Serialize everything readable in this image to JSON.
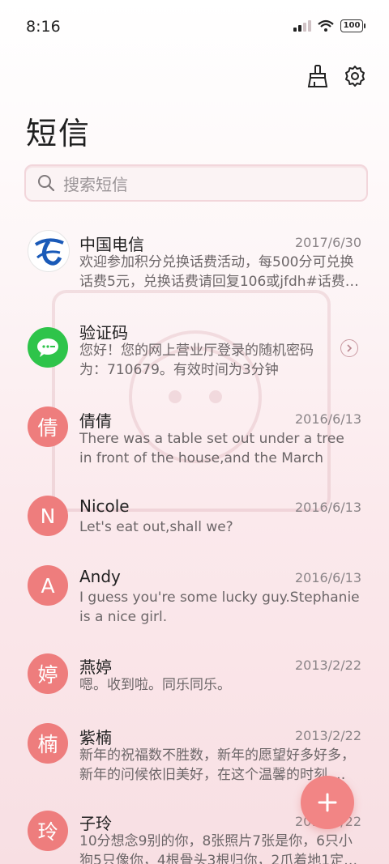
{
  "status": {
    "time": "8:16",
    "battery": "100"
  },
  "header": {
    "title": "短信"
  },
  "search": {
    "placeholder": "搜索短信"
  },
  "messages": [
    {
      "sender": "中国电信",
      "date": "2017/6/30",
      "preview": "欢迎参加积分兑换话费活动，每500分可兑换话费5元，兑换话费请回复106或jfdh#话费…",
      "avatar": "telecom-logo-icon"
    },
    {
      "sender": "验证码",
      "date": "",
      "preview": "您好！您的网上营业厅登录的随机密码为：710679。有效时间为3分钟",
      "avatar": "message-bubble-icon"
    },
    {
      "sender": "倩倩",
      "date": "2016/6/13",
      "preview": "There was a table set out under a tree in front of the house,and the March Hare an…",
      "avatar": "倩"
    },
    {
      "sender": "Nicole",
      "date": "2016/6/13",
      "preview": "Let's eat out,shall we?",
      "avatar": "N"
    },
    {
      "sender": "Andy",
      "date": "2016/6/13",
      "preview": "I guess you're some lucky guy.Stephanie is a nice girl.",
      "avatar": "A"
    },
    {
      "sender": "燕婷",
      "date": "2013/2/22",
      "preview": "嗯。收到啦。同乐同乐。",
      "avatar": "婷"
    },
    {
      "sender": "紫楠",
      "date": "2013/2/22",
      "preview": "新年的祝福数不胜数，新年的愿望好多好多，新年的问候依旧美好，在这个温馨的时刻 …",
      "avatar": "楠"
    },
    {
      "sender": "子玲",
      "date": "2013/2/22",
      "preview": "10分想念9别的你，8张照片7张是你，6只小狗5只像你，4根骨头3根归你，2爪着地1定…",
      "avatar": "玲"
    }
  ],
  "icons": {
    "clean": "broom-icon",
    "settings": "gear-icon",
    "search": "search-icon",
    "fab": "plus-icon"
  },
  "colors": {
    "avatar": "#ee7d7d",
    "fab": "#f28585",
    "green": "#2ec44a",
    "telecom_blue": "#1a5ab8"
  }
}
